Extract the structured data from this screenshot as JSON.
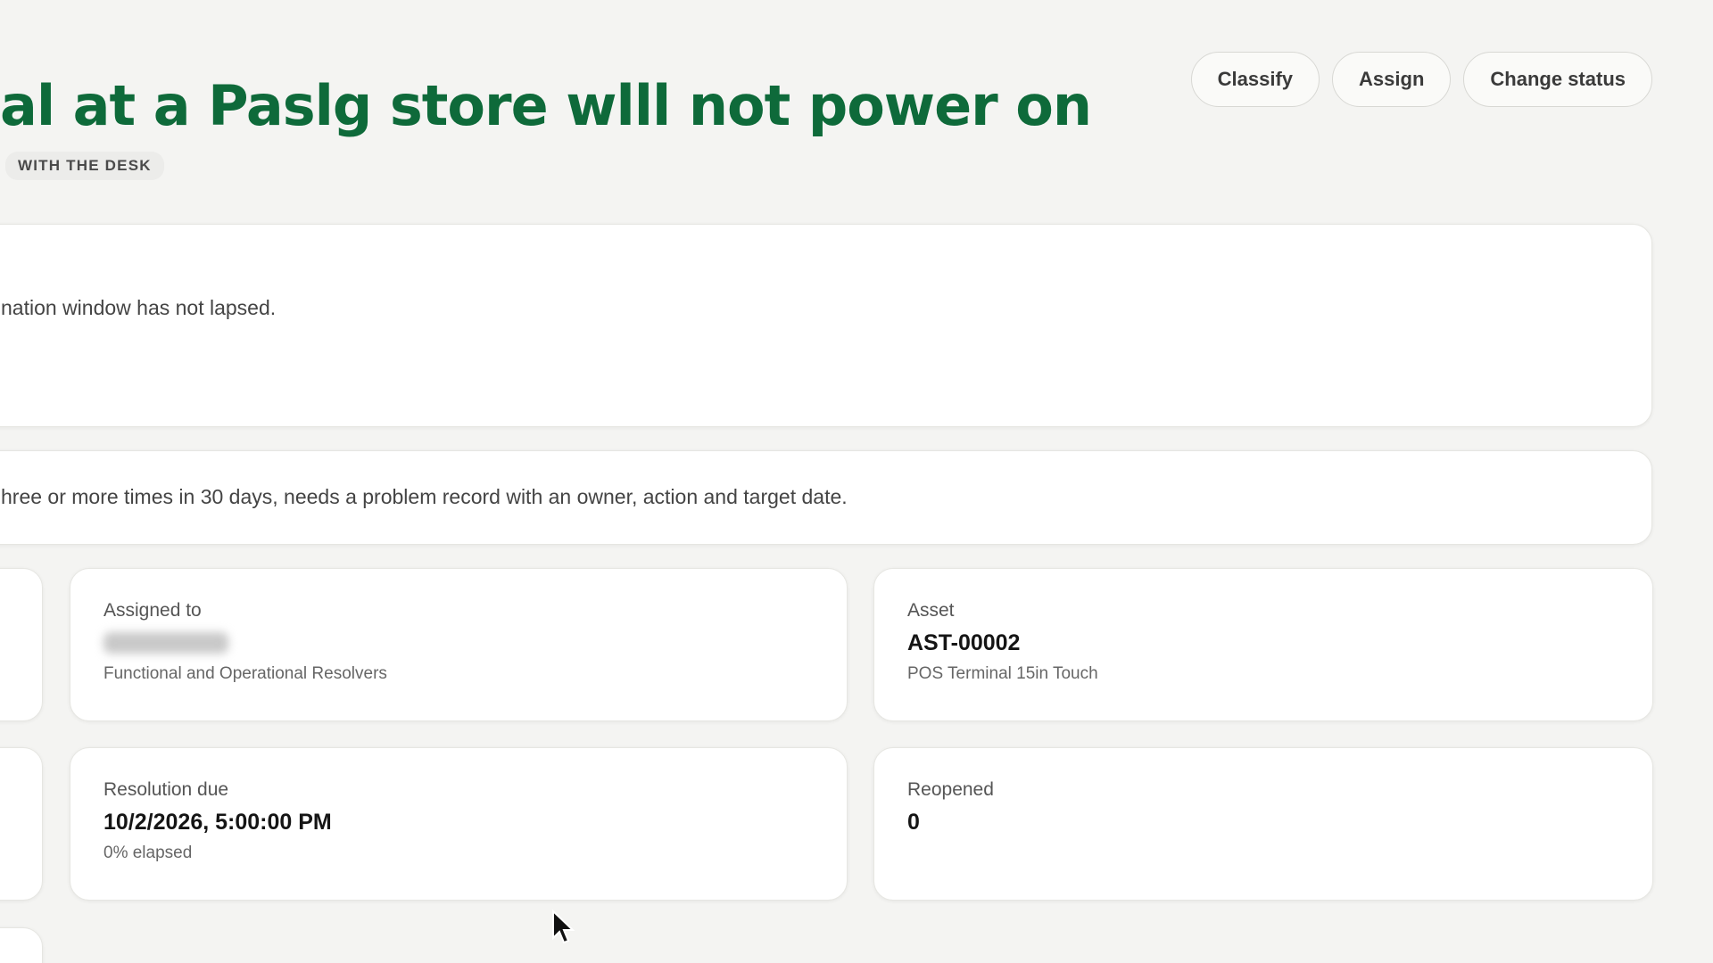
{
  "header": {
    "title": "al at a Paslg store wlll not power on",
    "status_badge": "WITH THE DESK"
  },
  "actions": {
    "classify": "Classify",
    "assign": "Assign",
    "change_status": "Change status"
  },
  "notice_card": {
    "text": "nation window has not lapsed."
  },
  "problem_card": {
    "text": "hree or more times in 30 days, needs a problem record with an owner, action and target date."
  },
  "assigned": {
    "label": "Assigned to",
    "group": "Functional and Operational Resolvers"
  },
  "asset": {
    "label": "Asset",
    "id": "AST-00002",
    "name": "POS Terminal 15in Touch"
  },
  "resolution": {
    "label": "Resolution due",
    "value": "10/2/2026, 5:00:00 PM",
    "elapsed": "0% elapsed"
  },
  "reopened": {
    "label": "Reopened",
    "value": "0"
  }
}
